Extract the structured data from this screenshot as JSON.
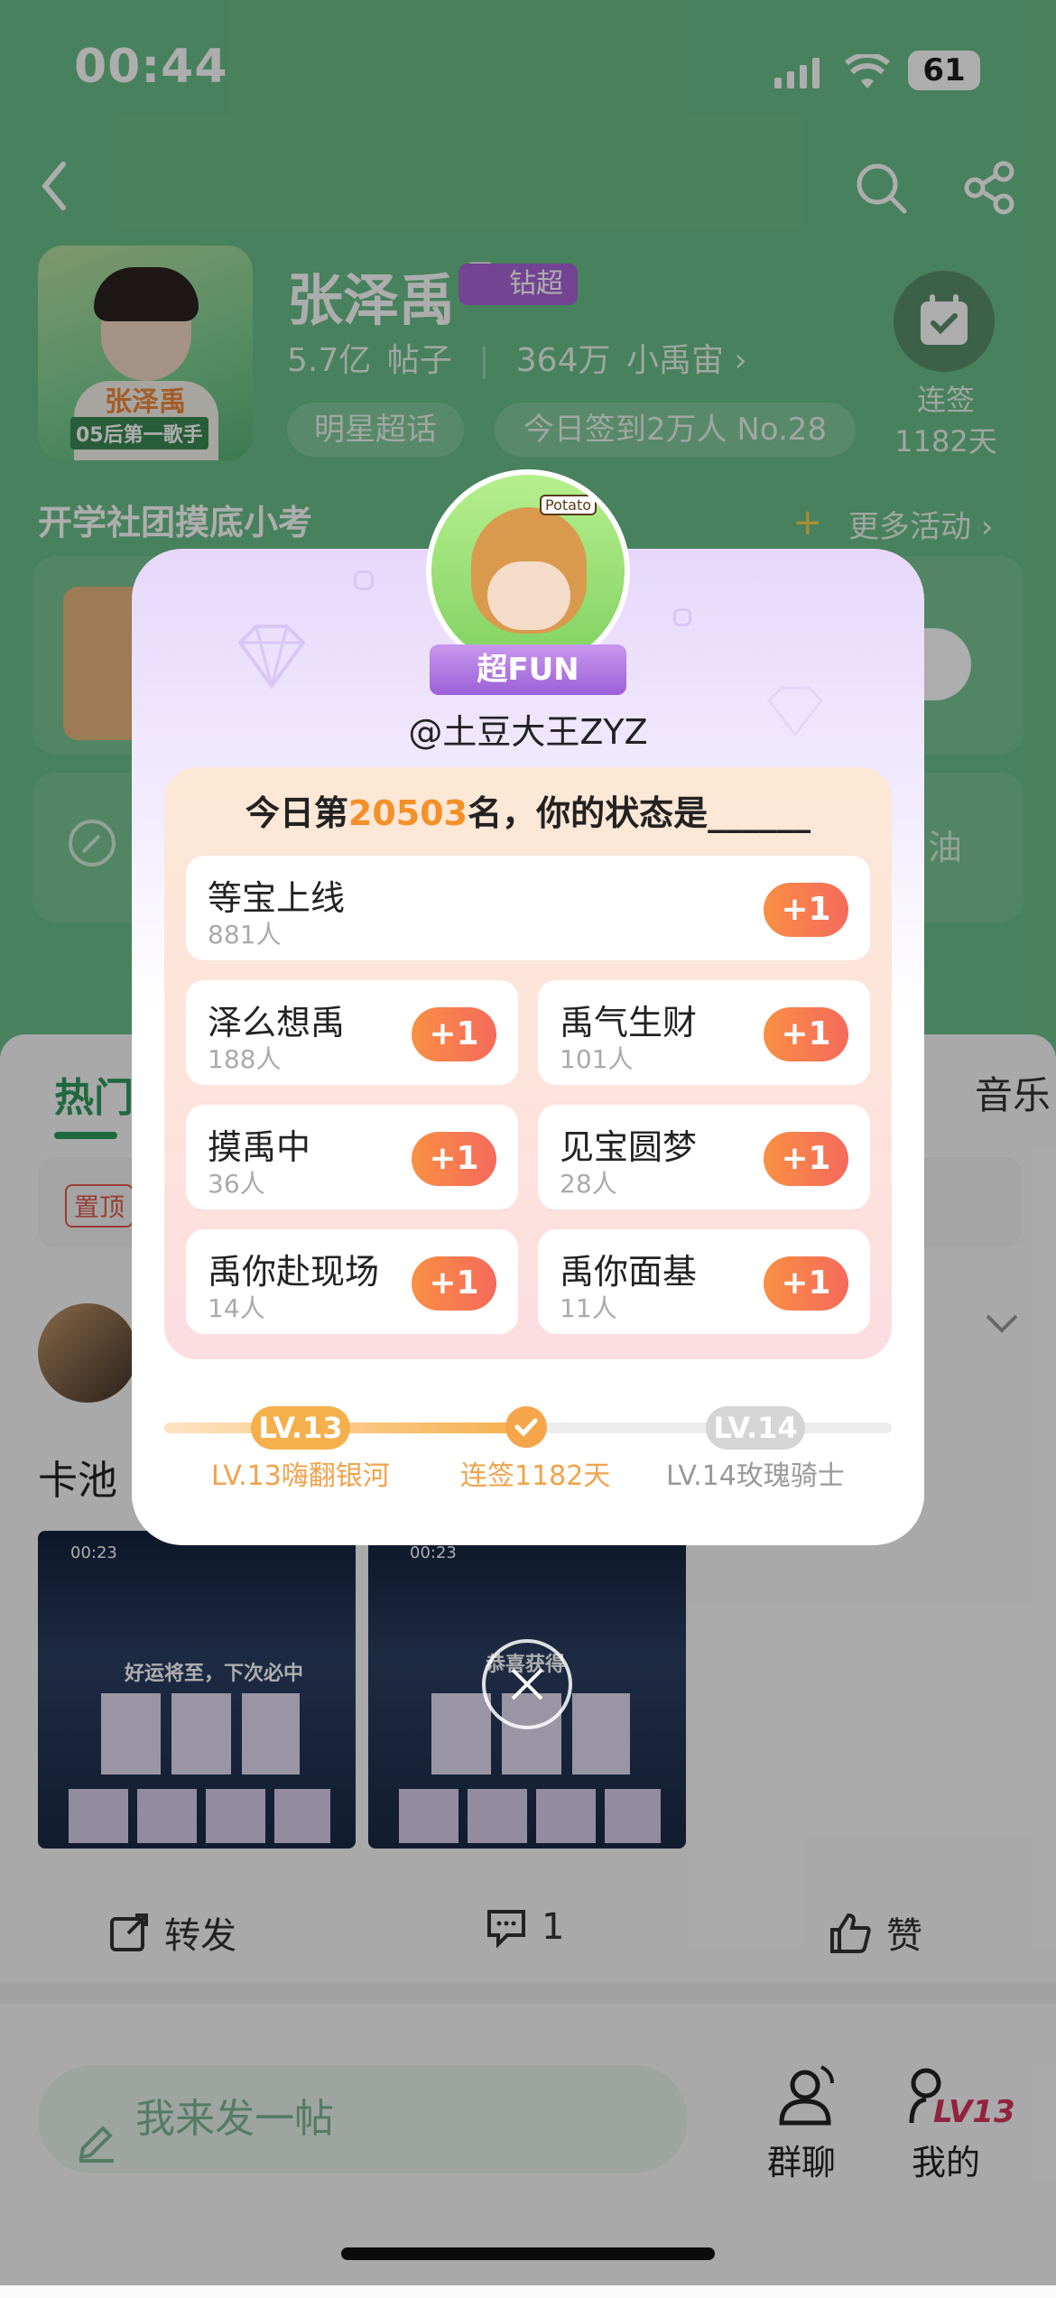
{
  "status_bar": {
    "time": "00:44",
    "battery": "61"
  },
  "header": {
    "star_name": "张泽禹",
    "badge": "钻超",
    "posts_count": "5.7亿",
    "posts_label": "帖子",
    "fans_count": "364万",
    "fans_label": "小禹宙",
    "chip_supertopic": "明星超话",
    "chip_checkin": "今日签到2万人 No.28",
    "checkin_label": "连签",
    "checkin_days": "1182天",
    "poster_text_1": "张泽禹",
    "poster_text_2": "05后第一歌手"
  },
  "activity": {
    "title": "开学社团摸底小考",
    "more": "更多活动",
    "banner_tail": "油"
  },
  "feed": {
    "tab_hot": "热门",
    "tab_music": "音乐",
    "pin": "置顶",
    "post_title": "卡池",
    "thumb_time_1": "00:23",
    "thumb_time_2": "00:23",
    "thumb_caption_1": "好运将至，下次必中",
    "thumb_caption_2": "恭喜获得",
    "action_share": "转发",
    "action_comment": "1",
    "action_like": "赞"
  },
  "bottom": {
    "compose_placeholder": "我来发一帖",
    "nav_group": "群聊",
    "nav_mine": "我的",
    "mine_level": "LV13"
  },
  "modal": {
    "avatar_text": "Potato",
    "ribbon": "超FUN",
    "username": "@土豆大王ZYZ",
    "prompt_prefix": "今日第",
    "rank": "20503",
    "prompt_suffix": "名，你的状态是______",
    "plus_label": "+1",
    "options": [
      {
        "title": "等宝上线",
        "count": "881人"
      },
      {
        "title": "泽么想禹",
        "count": "188人"
      },
      {
        "title": "禹气生财",
        "count": "101人"
      },
      {
        "title": "摸禹中",
        "count": "36人"
      },
      {
        "title": "见宝圆梦",
        "count": "28人"
      },
      {
        "title": "禹你赴现场",
        "count": "14人"
      },
      {
        "title": "禹你面基",
        "count": "11人"
      }
    ],
    "level_current": "LV.13",
    "level_next": "LV.14",
    "level_current_name": "LV.13嗨翻银河",
    "level_next_name": "LV.14玫瑰骑士",
    "streak": "连签1182天",
    "progress_fraction": 0.5
  },
  "colors": {
    "accent_green": "#2e9b5c",
    "orange": "#f39029",
    "purple": "#a865d8"
  }
}
